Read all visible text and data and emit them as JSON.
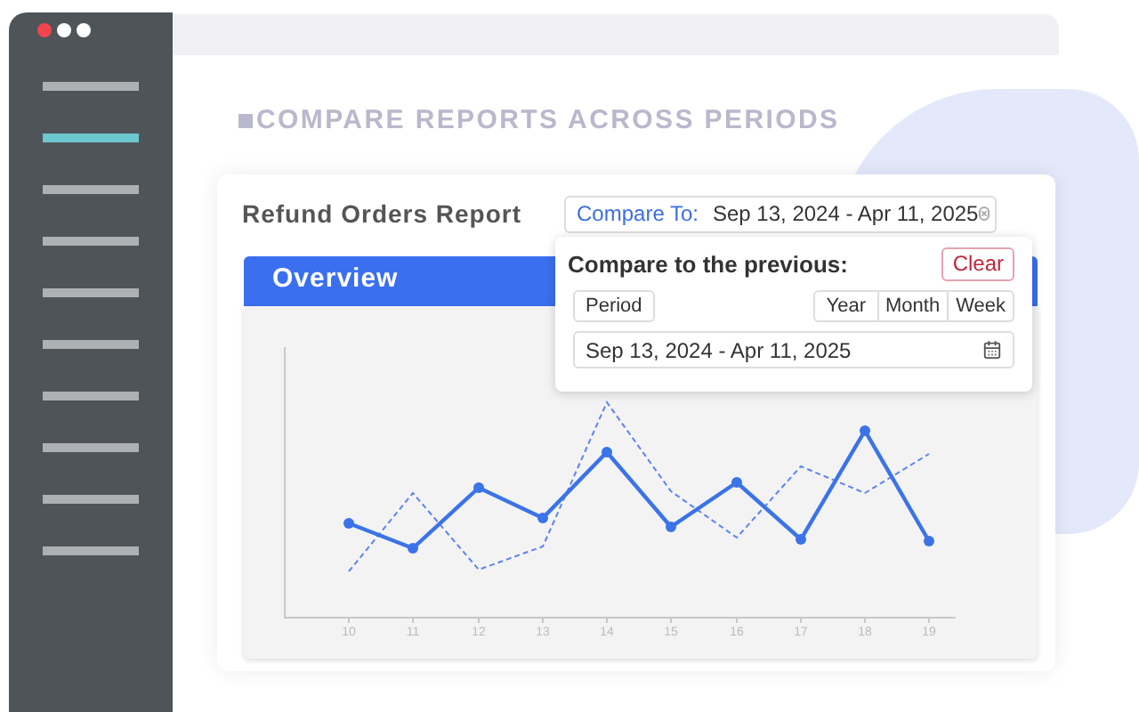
{
  "sidebar": {
    "items": [
      {
        "selected": false
      },
      {
        "selected": true
      },
      {
        "selected": false
      },
      {
        "selected": false
      },
      {
        "selected": false
      },
      {
        "selected": false
      },
      {
        "selected": false
      },
      {
        "selected": false
      },
      {
        "selected": false
      },
      {
        "selected": false
      }
    ]
  },
  "heading": "COMPARE REPORTS ACROSS PERIODS",
  "report": {
    "title": "Refund Orders Report",
    "compare_label": "Compare To:",
    "compare_value": "Sep 13, 2024 - Apr 11, 2025",
    "panel_title": "Overview",
    "x_labels": [
      "10",
      "11",
      "12",
      "13",
      "14",
      "15",
      "16",
      "17",
      "18",
      "19"
    ]
  },
  "popup": {
    "title": "Compare to the previous:",
    "clear": "Clear",
    "period": "Period",
    "ranges": [
      "Year",
      "Month",
      "Week"
    ],
    "date_value": "Sep 13, 2024 - Apr 11, 2025"
  }
}
